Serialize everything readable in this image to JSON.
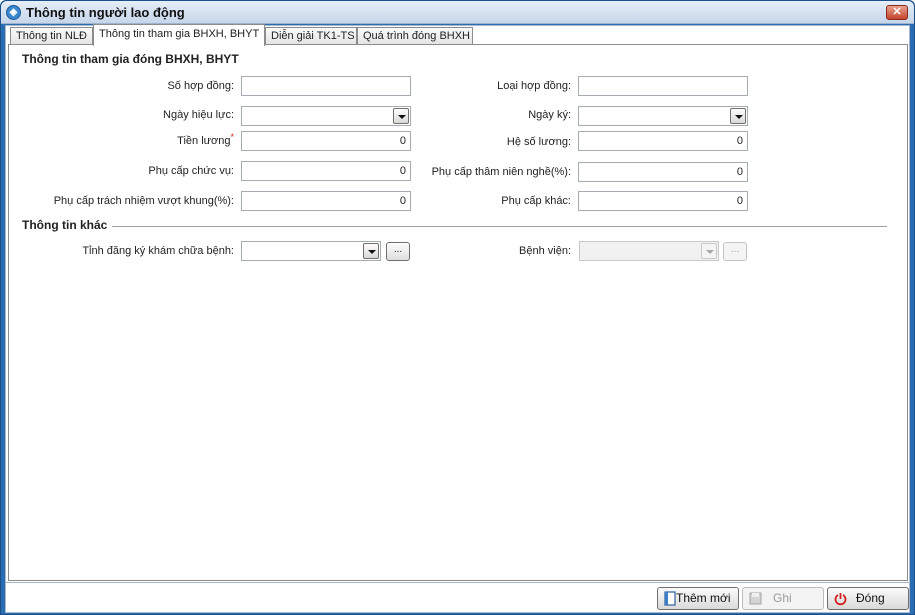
{
  "window": {
    "title": "Thông tin người lao động",
    "close_label": "✕"
  },
  "tabs": [
    {
      "label": "Thông tin NLĐ"
    },
    {
      "label": "Thông tin tham gia BHXH, BHYT"
    },
    {
      "label": "Diễn giải TK1-TS"
    },
    {
      "label": "Quá trình đóng BHXH"
    }
  ],
  "section_participation": {
    "title": "Thông tin tham gia đóng BHXH, BHYT",
    "contract_no_label": "Số hợp đồng:",
    "contract_no_value": "",
    "contract_type_label": "Loại hợp đồng:",
    "contract_type_value": "",
    "effective_date_label": "Ngày hiệu lực:",
    "effective_date_value": "",
    "sign_date_label": "Ngày ký:",
    "sign_date_value": "",
    "salary_label": "Tiền lương",
    "salary_required": "*",
    "salary_value": "0",
    "salary_coef_label": "Hệ số lương:",
    "salary_coef_value": "0",
    "position_allowance_label": "Phụ cấp chức vụ:",
    "position_allowance_value": "0",
    "seniority_allowance_label": "Phụ cấp thâm niên nghề(%):",
    "seniority_allowance_value": "0",
    "over_frame_allowance_label": "Phụ cấp trách nhiệm vượt khung(%):",
    "over_frame_allowance_value": "0",
    "other_allowance_label": "Phụ cấp khác:",
    "other_allowance_value": "0"
  },
  "section_other": {
    "title": "Thông tin khác",
    "province_label": "Tỉnh đăng ký khám chữa bệnh:",
    "province_value": "",
    "hospital_label": "Bệnh viện:",
    "hospital_value": "",
    "browse_label": "..."
  },
  "buttons": {
    "add_new": "Thêm mới",
    "save": "Ghi",
    "close": "Đóng"
  }
}
